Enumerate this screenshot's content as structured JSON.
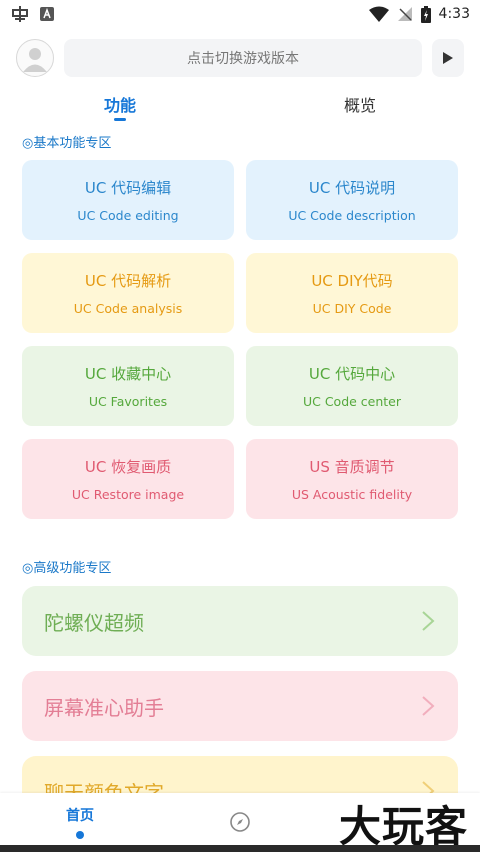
{
  "status_bar": {
    "time": "4:33"
  },
  "header": {
    "search_placeholder": "点击切换游戏版本"
  },
  "tabs": [
    {
      "label": "功能",
      "active": true
    },
    {
      "label": "概览",
      "active": false
    }
  ],
  "basic_section": {
    "title": "◎基本功能专区",
    "cards": [
      {
        "title": "UC 代码编辑",
        "subtitle": "UC Code editing",
        "color": "#2b87cc"
      },
      {
        "title": "UC 代码说明",
        "subtitle": "UC Code description",
        "color": "#2b87cc"
      },
      {
        "title": "UC 代码解析",
        "subtitle": "UC Code analysis",
        "color": "#e59a13"
      },
      {
        "title": "UC DIY代码",
        "subtitle": "UC DIY Code",
        "color": "#e59a13"
      },
      {
        "title": "UC 收藏中心",
        "subtitle": "UC Favorites",
        "color": "#55a83c"
      },
      {
        "title": "UC 代码中心",
        "subtitle": "UC Code center",
        "color": "#55a83c"
      },
      {
        "title": "UC 恢复画质",
        "subtitle": "UC Restore image",
        "color": "#e05a71"
      },
      {
        "title": "US 音质调节",
        "subtitle": "US Acoustic fidelity",
        "color": "#e05a71"
      }
    ]
  },
  "advanced_section": {
    "title": "◎高级功能专区",
    "items": [
      {
        "label": "陀螺仪超频",
        "color": "#6fae55"
      },
      {
        "label": "屏幕准心助手",
        "color": "#e37e95"
      },
      {
        "label": "聊天颜色文字",
        "color": "#e1a92a"
      }
    ]
  },
  "bottom_nav": {
    "home_label": "首页",
    "watermark": "大玩客"
  },
  "colors": {
    "accent": "#1677d8"
  }
}
